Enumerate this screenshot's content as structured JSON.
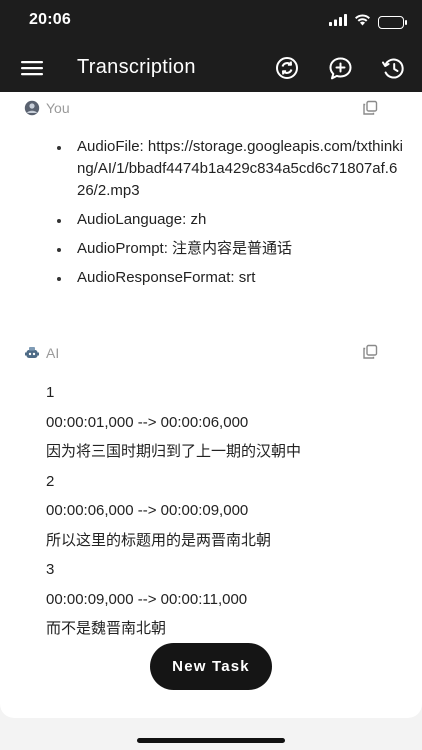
{
  "status": {
    "time": "20:06",
    "icons": [
      "signal-icon",
      "wifi-icon",
      "battery-icon"
    ]
  },
  "appbar": {
    "title": "Transcription",
    "actions": [
      "switch-model-icon",
      "new-chat-icon",
      "history-icon"
    ]
  },
  "messages": {
    "user": {
      "name": "You",
      "items": [
        "AudioFile: https://storage.googleapis.com/txthinking/AI/1/bbadf4474b1a429c834a5cd6c71807af.626/2.mp3",
        "AudioLanguage: zh",
        "AudioPrompt: 注意内容是普通话",
        "AudioResponseFormat: srt"
      ]
    },
    "ai": {
      "name": "AI",
      "lines": [
        "1",
        "00:00:01,000 --> 00:00:06,000",
        "因为将三国时期归到了上一期的汉朝中",
        "2",
        "00:00:06,000 --> 00:00:09,000",
        "所以这里的标题用的是两晋南北朝",
        "3",
        "00:00:09,000 --> 00:00:11,000",
        "而不是魏晋南北朝"
      ]
    }
  },
  "new_task_label": "New Task",
  "colors": {
    "bar": "#1d1d1d",
    "card": "#ffffff",
    "background": "#f3f3f3",
    "muted_text": "#9a9a9a"
  }
}
